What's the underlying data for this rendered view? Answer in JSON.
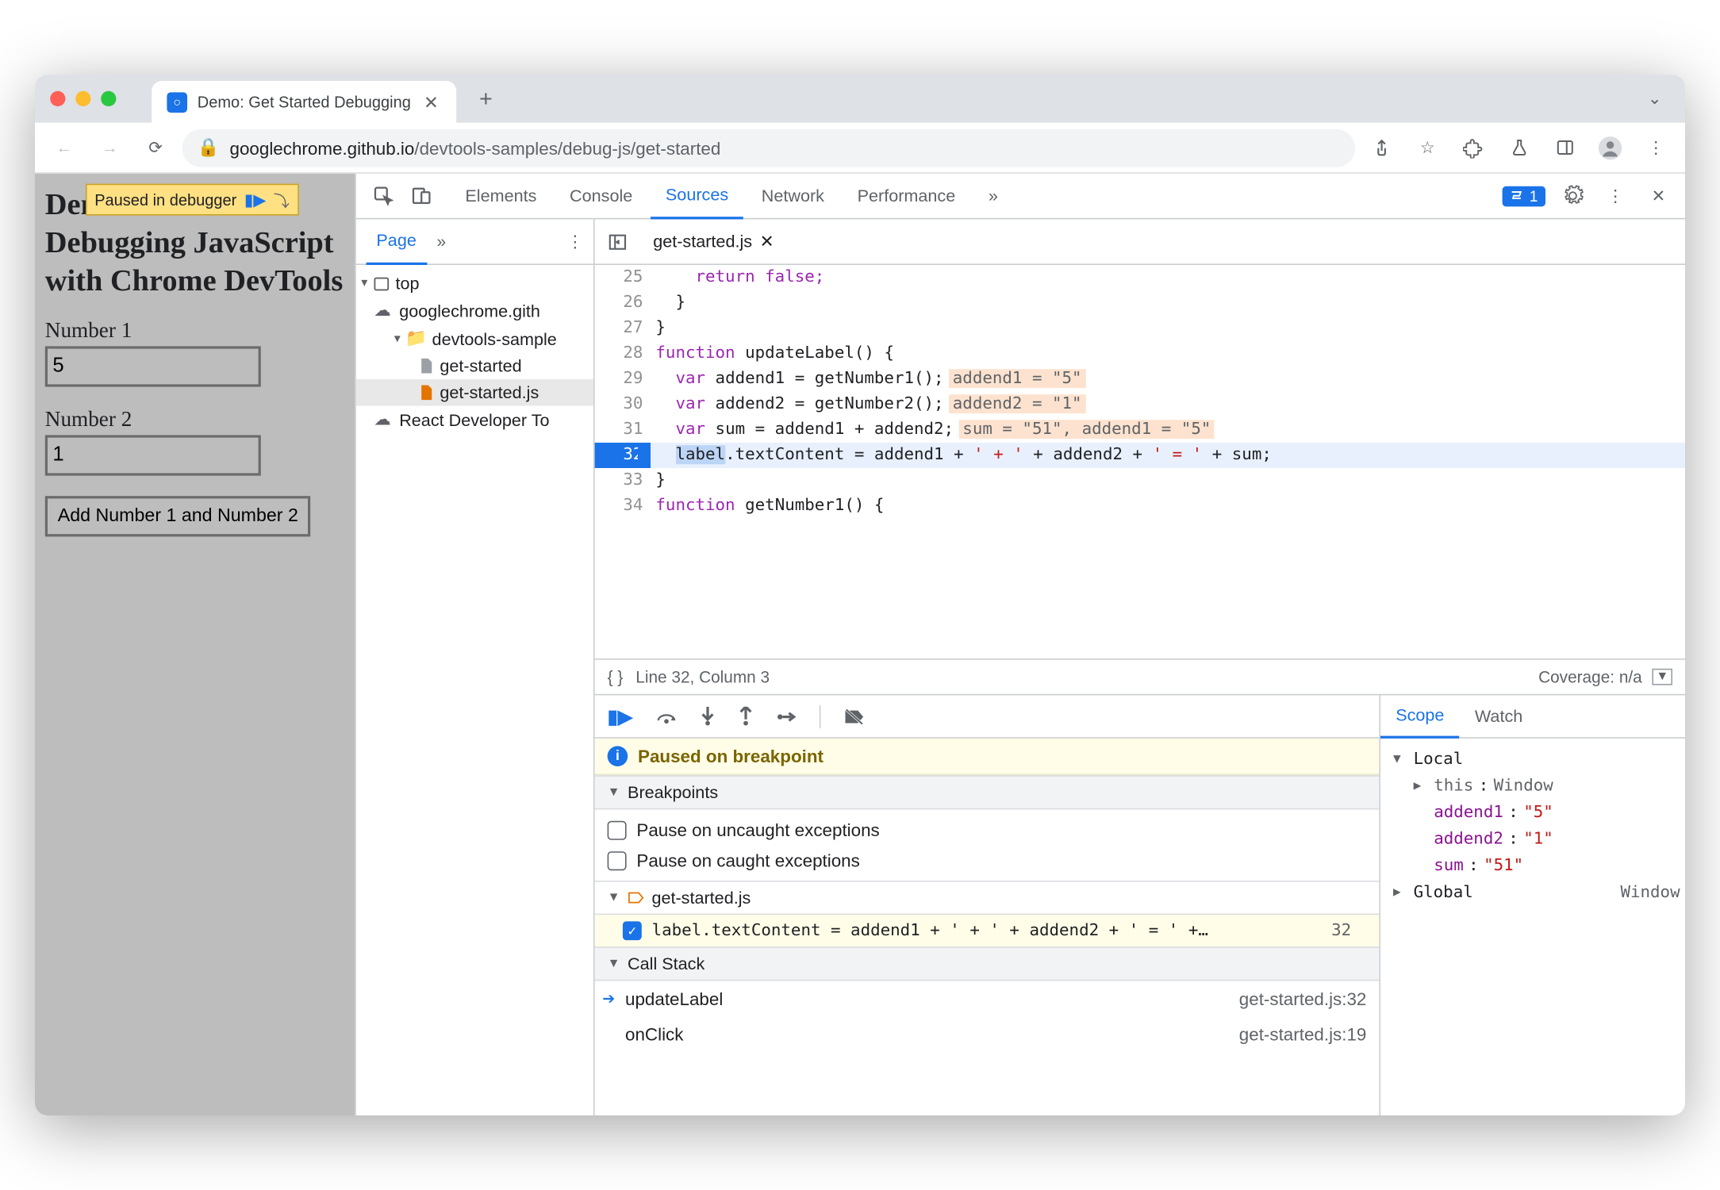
{
  "window": {
    "tab_title": "Demo: Get Started Debugging",
    "url_host": "googlechrome.github.io",
    "url_path": "/devtools-samples/debug-js/get-started"
  },
  "page": {
    "overlay": "Paused in debugger",
    "h1": "Demo: Get Started Debugging JavaScript with Chrome DevTools",
    "label1": "Number 1",
    "value1": "5",
    "label2": "Number 2",
    "value2": "1",
    "button": "Add Number 1 and Number 2"
  },
  "devtools": {
    "tabs": [
      "Elements",
      "Console",
      "Sources",
      "Network",
      "Performance"
    ],
    "issues_badge": "1",
    "nav": {
      "tab": "Page",
      "tree": {
        "top": "top",
        "domain": "googlechrome.gith",
        "folder": "devtools-sample",
        "file_html": "get-started",
        "file_js": "get-started.js",
        "ext": "React Developer To"
      }
    },
    "editor": {
      "filename": "get-started.js",
      "lines": {
        "25": "    return false;",
        "26": "  }",
        "27": "}",
        "28_fn": "function",
        "28_name": " updateLabel() {",
        "29_var": "  var",
        "29_rest": " addend1 = getNumber1();",
        "29_hint": "addend1 = \"5\"",
        "30_var": "  var",
        "30_rest": " addend2 = getNumber2();",
        "30_hint": "addend2 = \"1\"",
        "31_var": "  var",
        "31_rest": " sum = addend1 + addend2;",
        "31_hint": "sum = \"51\", addend1 = \"5\"",
        "32_a": "label",
        "32_b": ".textContent = addend1 + ",
        "32_s1": "' + '",
        "32_c": " + addend2 + ",
        "32_s2": "' = '",
        "32_d": " + sum;",
        "33": "}",
        "34_fn": "function",
        "34_name": " getNumber1() {"
      },
      "status_pos": "Line 32, Column 3",
      "status_cov": "Coverage: n/a"
    },
    "debugger": {
      "paused_msg": "Paused on breakpoint",
      "breakpoints_hdr": "Breakpoints",
      "pause_uncaught": "Pause on uncaught exceptions",
      "pause_caught": "Pause on caught exceptions",
      "bp_file": "get-started.js",
      "bp_text": "label.textContent = addend1 + ' + ' + addend2 + ' = ' +…",
      "bp_line": "32",
      "callstack_hdr": "Call Stack",
      "stack": [
        {
          "fn": "updateLabel",
          "loc": "get-started.js:32"
        },
        {
          "fn": "onClick",
          "loc": "get-started.js:19"
        }
      ],
      "scope_tabs": [
        "Scope",
        "Watch"
      ],
      "scope": {
        "local": "Local",
        "this_k": "this",
        "this_v": "Window",
        "a1_k": "addend1",
        "a1_v": "\"5\"",
        "a2_k": "addend2",
        "a2_v": "\"1\"",
        "sum_k": "sum",
        "sum_v": "\"51\"",
        "global": "Global",
        "global_v": "Window"
      }
    }
  }
}
